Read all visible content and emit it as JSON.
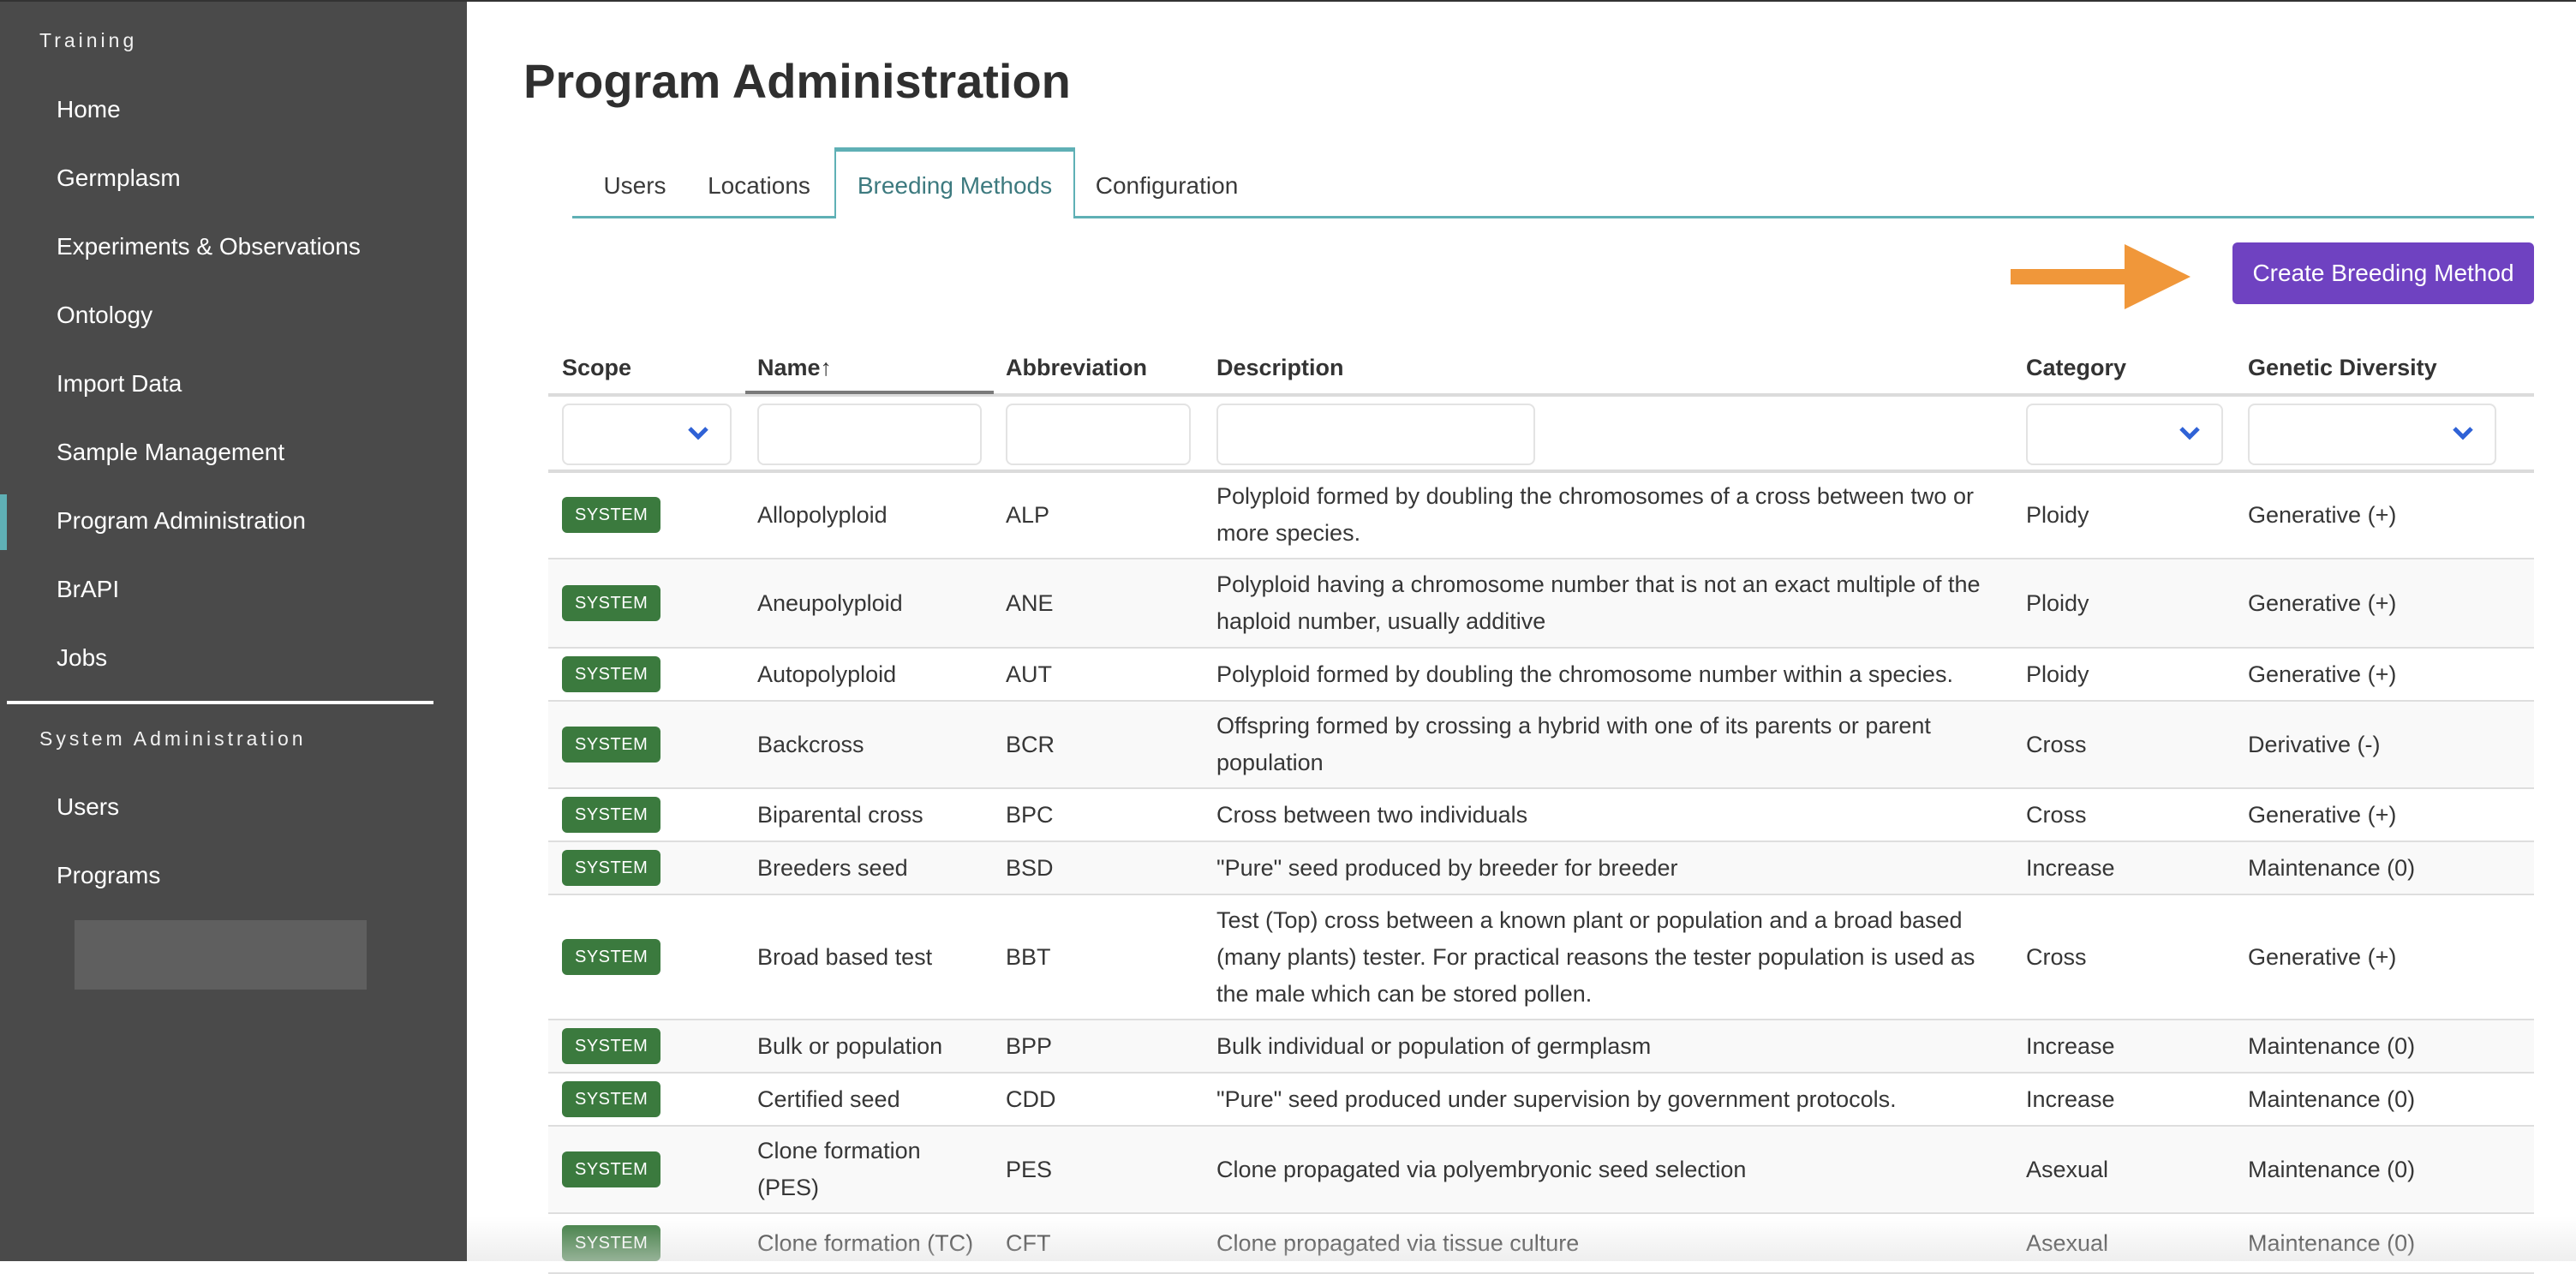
{
  "sidebar": {
    "section_training": "Training",
    "items": [
      {
        "label": "Home"
      },
      {
        "label": "Germplasm"
      },
      {
        "label": "Experiments & Observations"
      },
      {
        "label": "Ontology"
      },
      {
        "label": "Import Data"
      },
      {
        "label": "Sample Management"
      },
      {
        "label": "Program Administration",
        "active": true
      },
      {
        "label": "BrAPI"
      },
      {
        "label": "Jobs"
      }
    ],
    "section_system": "System Administration",
    "system_items": [
      {
        "label": "Users"
      },
      {
        "label": "Programs"
      }
    ]
  },
  "page": {
    "title": "Program Administration"
  },
  "tabs": [
    {
      "label": "Users"
    },
    {
      "label": "Locations"
    },
    {
      "label": "Breeding Methods",
      "active": true
    },
    {
      "label": "Configuration"
    }
  ],
  "toolbar": {
    "create_label": "Create Breeding Method",
    "create_color": "#6f42c1",
    "annotation_arrow_color": "#f0973a"
  },
  "table": {
    "columns": {
      "scope": "Scope",
      "name": "Name",
      "name_sort": "↑",
      "abbreviation": "Abbreviation",
      "description": "Description",
      "category": "Category",
      "genetic_diversity": "Genetic Diversity"
    },
    "filters": {
      "scope": "",
      "name": "",
      "abbreviation": "",
      "description": "",
      "category": "",
      "genetic_diversity": ""
    },
    "rows": [
      {
        "scope": "SYSTEM",
        "name": "Allopolyploid",
        "abbreviation": "ALP",
        "description": "Polyploid formed by doubling the chromosomes of a cross between two or more species.",
        "category": "Ploidy",
        "genetic_diversity": "Generative (+)"
      },
      {
        "scope": "SYSTEM",
        "name": "Aneupolyploid",
        "abbreviation": "ANE",
        "description": "Polyploid having a chromosome number that is not an exact multiple of the haploid number, usually additive",
        "category": "Ploidy",
        "genetic_diversity": "Generative (+)"
      },
      {
        "scope": "SYSTEM",
        "name": "Autopolyploid",
        "abbreviation": "AUT",
        "description": "Polyploid formed by doubling the chromosome number within a species.",
        "category": "Ploidy",
        "genetic_diversity": "Generative (+)"
      },
      {
        "scope": "SYSTEM",
        "name": "Backcross",
        "abbreviation": "BCR",
        "description": "Offspring formed by crossing a hybrid with one of its parents or parent population",
        "category": "Cross",
        "genetic_diversity": "Derivative (-)"
      },
      {
        "scope": "SYSTEM",
        "name": "Biparental cross",
        "abbreviation": "BPC",
        "description": "Cross between two individuals",
        "category": "Cross",
        "genetic_diversity": "Generative (+)"
      },
      {
        "scope": "SYSTEM",
        "name": "Breeders seed",
        "abbreviation": "BSD",
        "description": "\"Pure\" seed produced by breeder for breeder",
        "category": "Increase",
        "genetic_diversity": "Maintenance (0)"
      },
      {
        "scope": "SYSTEM",
        "name": "Broad based test",
        "abbreviation": "BBT",
        "description": "Test (Top) cross between a known plant or population and a broad based (many plants) tester. For practical reasons the tester population is used as the male which can be stored pollen.",
        "category": "Cross",
        "genetic_diversity": "Generative (+)"
      },
      {
        "scope": "SYSTEM",
        "name": "Bulk or population",
        "abbreviation": "BPP",
        "description": "Bulk individual or population of germplasm",
        "category": "Increase",
        "genetic_diversity": "Maintenance (0)"
      },
      {
        "scope": "SYSTEM",
        "name": "Certified seed",
        "abbreviation": "CDD",
        "description": "\"Pure\" seed produced under supervision by government protocols.",
        "category": "Increase",
        "genetic_diversity": "Maintenance (0)"
      },
      {
        "scope": "SYSTEM",
        "name": "Clone formation (PES)",
        "abbreviation": "PES",
        "description": "Clone propagated via polyembryonic seed selection",
        "category": "Asexual",
        "genetic_diversity": "Maintenance (0)"
      },
      {
        "scope": "SYSTEM",
        "name": "Clone formation (TC)",
        "abbreviation": "CFT",
        "description": "Clone propagated via tissue culture",
        "category": "Asexual",
        "genetic_diversity": "Maintenance (0)"
      }
    ],
    "badge_color": "#3b7a3e",
    "accent_color": "#5fb0b5"
  }
}
